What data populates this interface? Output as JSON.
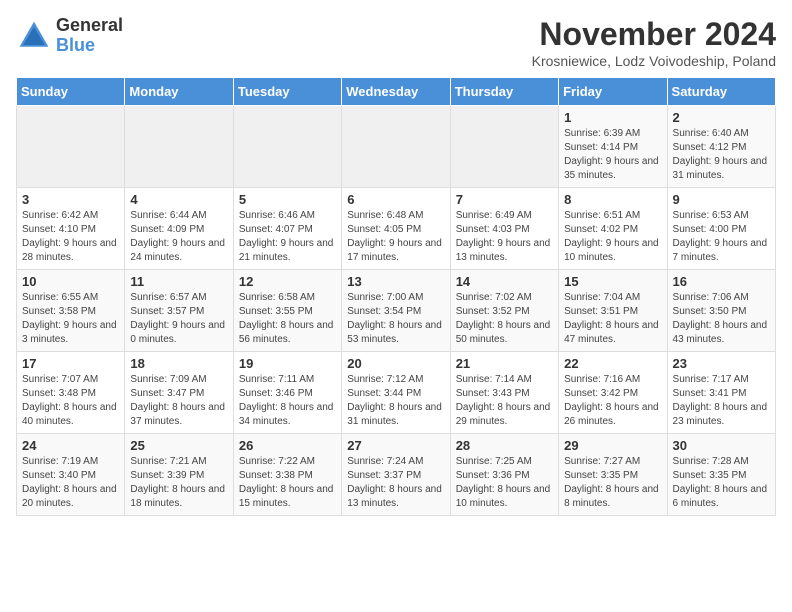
{
  "header": {
    "logo": {
      "general": "General",
      "blue": "Blue"
    },
    "title": "November 2024",
    "location": "Krosniewice, Lodz Voivodeship, Poland"
  },
  "weekdays": [
    "Sunday",
    "Monday",
    "Tuesday",
    "Wednesday",
    "Thursday",
    "Friday",
    "Saturday"
  ],
  "weeks": [
    [
      {
        "day": "",
        "info": ""
      },
      {
        "day": "",
        "info": ""
      },
      {
        "day": "",
        "info": ""
      },
      {
        "day": "",
        "info": ""
      },
      {
        "day": "",
        "info": ""
      },
      {
        "day": "1",
        "info": "Sunrise: 6:39 AM\nSunset: 4:14 PM\nDaylight: 9 hours and 35 minutes."
      },
      {
        "day": "2",
        "info": "Sunrise: 6:40 AM\nSunset: 4:12 PM\nDaylight: 9 hours and 31 minutes."
      }
    ],
    [
      {
        "day": "3",
        "info": "Sunrise: 6:42 AM\nSunset: 4:10 PM\nDaylight: 9 hours and 28 minutes."
      },
      {
        "day": "4",
        "info": "Sunrise: 6:44 AM\nSunset: 4:09 PM\nDaylight: 9 hours and 24 minutes."
      },
      {
        "day": "5",
        "info": "Sunrise: 6:46 AM\nSunset: 4:07 PM\nDaylight: 9 hours and 21 minutes."
      },
      {
        "day": "6",
        "info": "Sunrise: 6:48 AM\nSunset: 4:05 PM\nDaylight: 9 hours and 17 minutes."
      },
      {
        "day": "7",
        "info": "Sunrise: 6:49 AM\nSunset: 4:03 PM\nDaylight: 9 hours and 13 minutes."
      },
      {
        "day": "8",
        "info": "Sunrise: 6:51 AM\nSunset: 4:02 PM\nDaylight: 9 hours and 10 minutes."
      },
      {
        "day": "9",
        "info": "Sunrise: 6:53 AM\nSunset: 4:00 PM\nDaylight: 9 hours and 7 minutes."
      }
    ],
    [
      {
        "day": "10",
        "info": "Sunrise: 6:55 AM\nSunset: 3:58 PM\nDaylight: 9 hours and 3 minutes."
      },
      {
        "day": "11",
        "info": "Sunrise: 6:57 AM\nSunset: 3:57 PM\nDaylight: 9 hours and 0 minutes."
      },
      {
        "day": "12",
        "info": "Sunrise: 6:58 AM\nSunset: 3:55 PM\nDaylight: 8 hours and 56 minutes."
      },
      {
        "day": "13",
        "info": "Sunrise: 7:00 AM\nSunset: 3:54 PM\nDaylight: 8 hours and 53 minutes."
      },
      {
        "day": "14",
        "info": "Sunrise: 7:02 AM\nSunset: 3:52 PM\nDaylight: 8 hours and 50 minutes."
      },
      {
        "day": "15",
        "info": "Sunrise: 7:04 AM\nSunset: 3:51 PM\nDaylight: 8 hours and 47 minutes."
      },
      {
        "day": "16",
        "info": "Sunrise: 7:06 AM\nSunset: 3:50 PM\nDaylight: 8 hours and 43 minutes."
      }
    ],
    [
      {
        "day": "17",
        "info": "Sunrise: 7:07 AM\nSunset: 3:48 PM\nDaylight: 8 hours and 40 minutes."
      },
      {
        "day": "18",
        "info": "Sunrise: 7:09 AM\nSunset: 3:47 PM\nDaylight: 8 hours and 37 minutes."
      },
      {
        "day": "19",
        "info": "Sunrise: 7:11 AM\nSunset: 3:46 PM\nDaylight: 8 hours and 34 minutes."
      },
      {
        "day": "20",
        "info": "Sunrise: 7:12 AM\nSunset: 3:44 PM\nDaylight: 8 hours and 31 minutes."
      },
      {
        "day": "21",
        "info": "Sunrise: 7:14 AM\nSunset: 3:43 PM\nDaylight: 8 hours and 29 minutes."
      },
      {
        "day": "22",
        "info": "Sunrise: 7:16 AM\nSunset: 3:42 PM\nDaylight: 8 hours and 26 minutes."
      },
      {
        "day": "23",
        "info": "Sunrise: 7:17 AM\nSunset: 3:41 PM\nDaylight: 8 hours and 23 minutes."
      }
    ],
    [
      {
        "day": "24",
        "info": "Sunrise: 7:19 AM\nSunset: 3:40 PM\nDaylight: 8 hours and 20 minutes."
      },
      {
        "day": "25",
        "info": "Sunrise: 7:21 AM\nSunset: 3:39 PM\nDaylight: 8 hours and 18 minutes."
      },
      {
        "day": "26",
        "info": "Sunrise: 7:22 AM\nSunset: 3:38 PM\nDaylight: 8 hours and 15 minutes."
      },
      {
        "day": "27",
        "info": "Sunrise: 7:24 AM\nSunset: 3:37 PM\nDaylight: 8 hours and 13 minutes."
      },
      {
        "day": "28",
        "info": "Sunrise: 7:25 AM\nSunset: 3:36 PM\nDaylight: 8 hours and 10 minutes."
      },
      {
        "day": "29",
        "info": "Sunrise: 7:27 AM\nSunset: 3:35 PM\nDaylight: 8 hours and 8 minutes."
      },
      {
        "day": "30",
        "info": "Sunrise: 7:28 AM\nSunset: 3:35 PM\nDaylight: 8 hours and 6 minutes."
      }
    ]
  ]
}
